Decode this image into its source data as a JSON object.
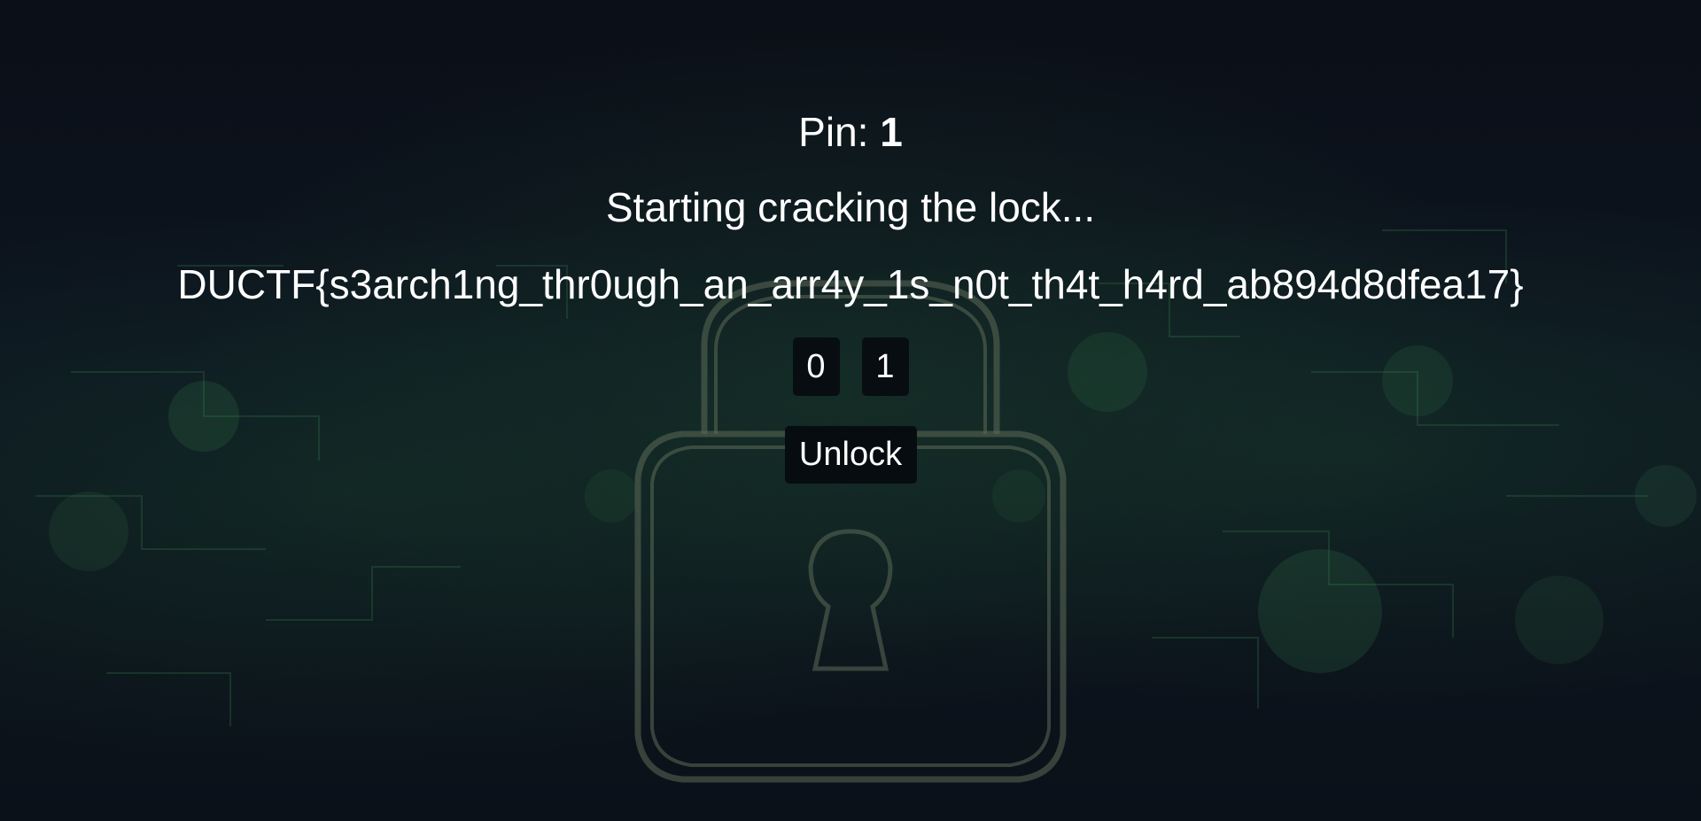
{
  "pin": {
    "label": "Pin:",
    "value": "1"
  },
  "status": {
    "message": "Starting cracking the lock..."
  },
  "flag": {
    "text": "DUCTF{s3arch1ng_thr0ugh_an_arr4y_1s_n0t_th4t_h4rd_ab894d8dfea17}"
  },
  "lock_digits": [
    "0",
    "1"
  ],
  "unlock_button": {
    "label": "Unlock"
  },
  "background": {
    "icon": "padlock-icon",
    "colors": {
      "base": "#0b111b",
      "circuit_glow": "#3f8a52",
      "lock_outline": "#4a5a4a"
    }
  }
}
